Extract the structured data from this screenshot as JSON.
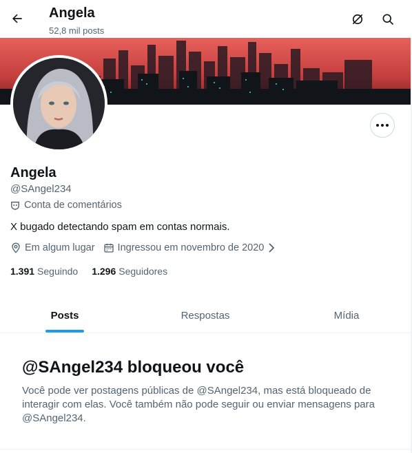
{
  "header": {
    "title": "Angela",
    "posts_count": "52,8 mil posts"
  },
  "profile": {
    "name": "Angela",
    "handle": "@SAngel234",
    "account_label": "Conta de comentários",
    "bio": "X bugado detectando spam em contas normais.",
    "location": "Em algum lugar",
    "joined": "Ingressou em novembro de 2020",
    "following_count": "1.391",
    "following_label": "Seguindo",
    "followers_count": "1.296",
    "followers_label": "Seguidores"
  },
  "tabs": [
    {
      "label": "Posts",
      "active": true
    },
    {
      "label": "Respostas",
      "active": false
    },
    {
      "label": "Mídia",
      "active": false
    }
  ],
  "blocked": {
    "title": "@SAngel234 bloqueou você",
    "message": "Você pode ver postagens públicas de @SAngel234, mas está bloqueado de interagir com elas. Você também não pode seguir ou enviar mensagens para @SAngel234."
  },
  "colors": {
    "accent": "#1d9bf0",
    "text": "#0f1419",
    "secondary_text": "#536471",
    "banner_red": "#d64848"
  }
}
